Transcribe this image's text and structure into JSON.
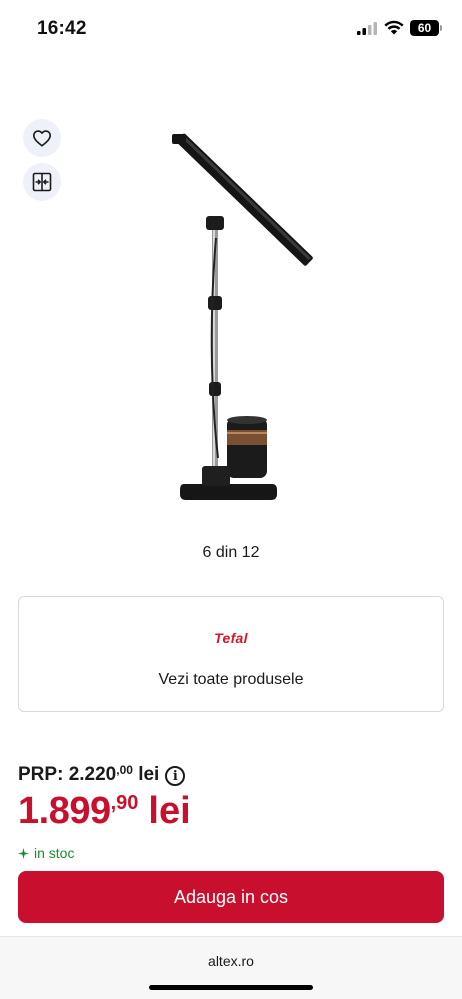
{
  "status_bar": {
    "time": "16:42",
    "battery": "60",
    "icons": [
      "signal-icon",
      "wifi-icon",
      "battery-icon"
    ]
  },
  "actions": {
    "favorite_icon": "heart-icon",
    "compare_icon": "compare-icon"
  },
  "gallery": {
    "counter": "6 din 12"
  },
  "brand": {
    "logo_text": "Tefal",
    "link_label": "Vezi toate produsele"
  },
  "pricing": {
    "prp_label": "PRP:",
    "prp_value": "2.220",
    "prp_decimals": ",00",
    "prp_currency": "lei",
    "price_value": "1.899",
    "price_decimals": ",90",
    "price_currency": "lei"
  },
  "stock": {
    "label": "in stoc"
  },
  "cart": {
    "button_label": "Adauga in cos"
  },
  "browser": {
    "url": "altex.ro"
  },
  "colors": {
    "accent": "#c8102e",
    "stock_green": "#1e8a2e",
    "brand_red": "#d4182a"
  }
}
